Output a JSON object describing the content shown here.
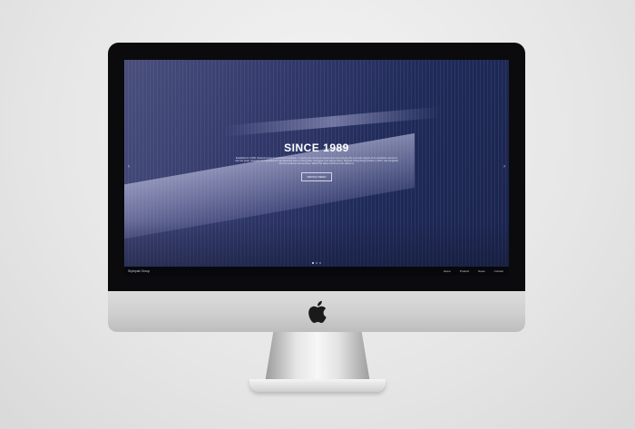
{
  "hero": {
    "title": "SINCE 1989",
    "description": "Established in 1989, Stylepak Group is dedicated to produce... meeting the increased requirements and enjoying the trust and support of its worldwide customers over the years. Stylepak has expanded its manufacturing base in Zhongshan, Dongguan and Jiangxi China. Stylepak (Hong Kong) Limited, in 2014, has integrated all of its resources and services. Watch this video and know more about us.",
    "button_label": "WATCH VIDEO"
  },
  "footer": {
    "brand": "Stylepak Group",
    "nav": [
      "Home",
      "Product",
      "News",
      "Contact"
    ]
  },
  "slider": {
    "slide_count": 3,
    "active_index": 0
  },
  "colors": {
    "screen_bg": "#1f2a58",
    "footer_bg": "#07080c",
    "bezel": "#0b0b0d"
  }
}
